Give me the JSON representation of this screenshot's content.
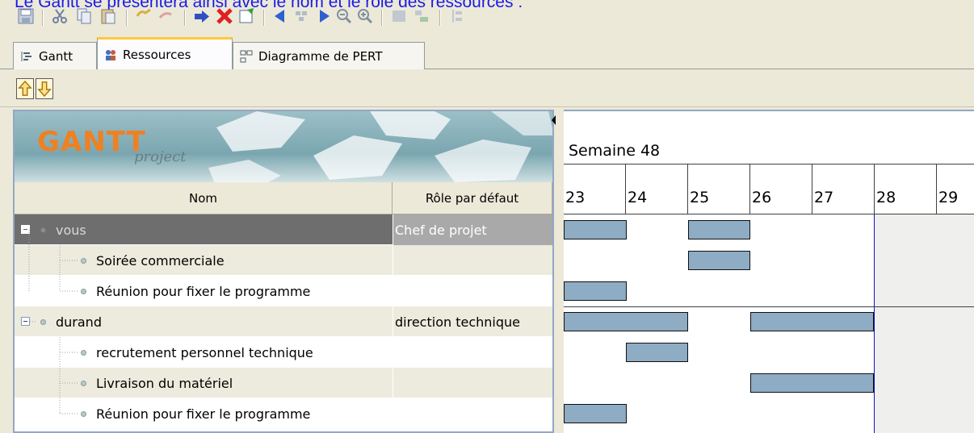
{
  "caption": "Le Gantt se présentera ainsi avec le nom et le rôle des ressources :",
  "tabs": [
    {
      "label": "Gantt",
      "icon": "gantt-icon"
    },
    {
      "label": "Ressources",
      "icon": "resources-icon"
    },
    {
      "label": "Diagramme de PERT",
      "icon": "pert-icon"
    }
  ],
  "logo": {
    "word": "GANTT",
    "sub": "project"
  },
  "table": {
    "col_name": "Nom",
    "col_role": "Rôle par défaut",
    "rows": [
      {
        "name": "vous",
        "role": "Chef de projet"
      },
      {
        "name": "Soirée commerciale",
        "role": ""
      },
      {
        "name": "Réunion pour fixer le programme",
        "role": ""
      },
      {
        "name": "durand",
        "role": "direction technique"
      },
      {
        "name": "recrutement personnel technique",
        "role": ""
      },
      {
        "name": "Livraison du matériel",
        "role": ""
      },
      {
        "name": "Réunion pour fixer le programme",
        "role": ""
      }
    ]
  },
  "chart": {
    "week": "Semaine 48",
    "days": [
      "23",
      "24",
      "25",
      "26",
      "27",
      "28",
      "29"
    ]
  },
  "colors": {
    "bar": "#8eacc4",
    "selected_row": "#6e6e6e",
    "today_line": "#1010c8",
    "caption": "#1a1ae6"
  }
}
